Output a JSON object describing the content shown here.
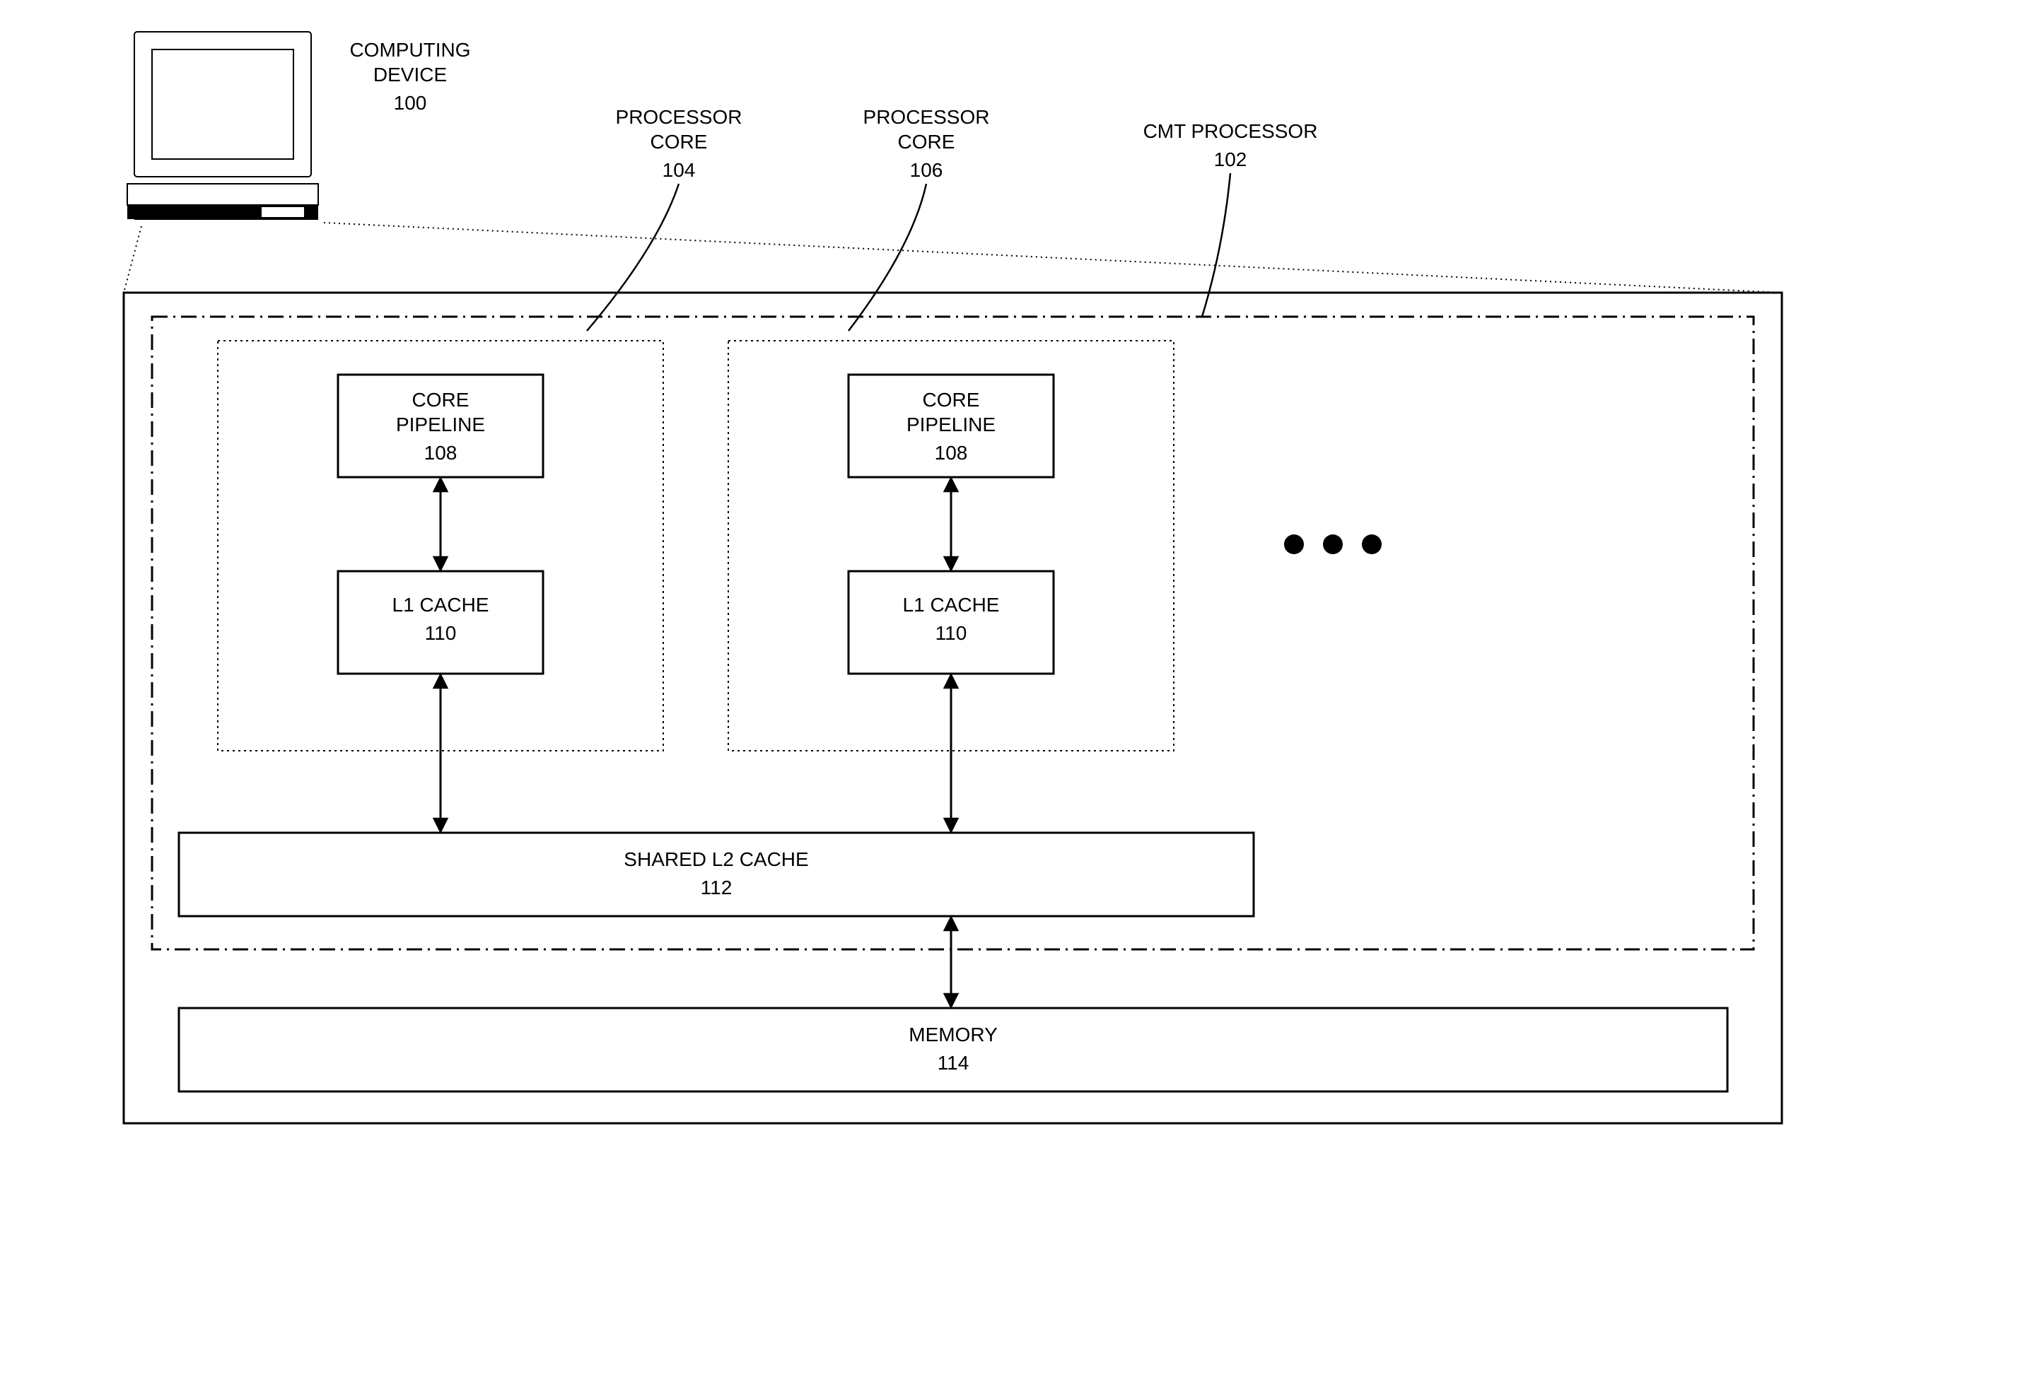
{
  "labels": {
    "computing_device_line1": "COMPUTING",
    "computing_device_line2": "DEVICE",
    "computing_device_num": "100",
    "processor_core_a_line1": "PROCESSOR",
    "processor_core_a_line2": "CORE",
    "processor_core_a_num": "104",
    "processor_core_b_line1": "PROCESSOR",
    "processor_core_b_line2": "CORE",
    "processor_core_b_num": "106",
    "cmt_line1": "CMT PROCESSOR",
    "cmt_num": "102",
    "core_pipeline_line1": "CORE",
    "core_pipeline_line2": "PIPELINE",
    "core_pipeline_num": "108",
    "l1_line1": "L1 CACHE",
    "l1_num": "110",
    "l2_line1": "SHARED L2 CACHE",
    "l2_num": "112",
    "mem_line1": "MEMORY",
    "mem_num": "114"
  }
}
